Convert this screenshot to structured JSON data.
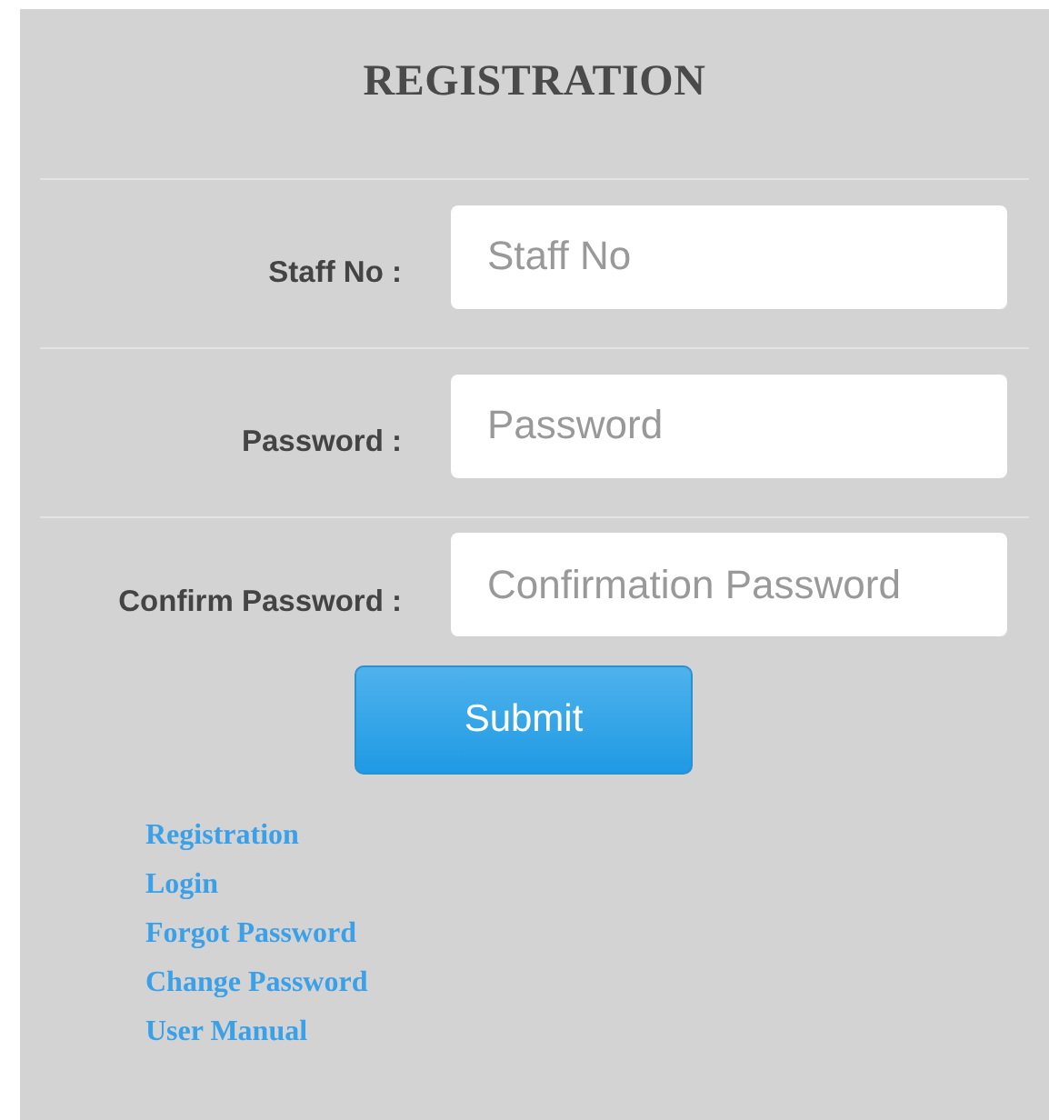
{
  "title": "REGISTRATION",
  "fields": [
    {
      "label": "Staff No :",
      "placeholder": "Staff No"
    },
    {
      "label": "Password :",
      "placeholder": "Password"
    },
    {
      "label": "Confirm Password :",
      "placeholder": "Confirmation Password"
    }
  ],
  "submit": "Submit",
  "links": [
    "Registration",
    "Login",
    "Forgot Password",
    "Change Password",
    "User Manual"
  ]
}
